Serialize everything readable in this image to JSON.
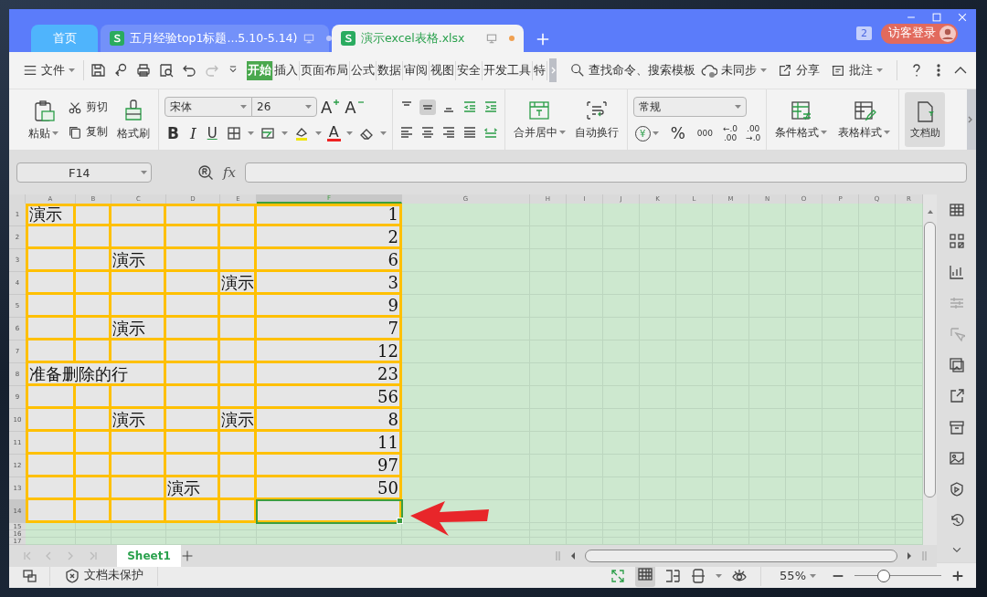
{
  "title_tabs": [
    {
      "kind": "home",
      "label": "首页",
      "selected": false
    },
    {
      "kind": "doc",
      "label": "五月经验top1标题...5.10-5.14)",
      "selected": false
    },
    {
      "kind": "doc",
      "label": "演示excel表格.xlsx",
      "selected": true
    }
  ],
  "window_count": "2",
  "login": "访客登录",
  "file_menu": "文件",
  "menu_tabs": [
    {
      "label": "开始",
      "selected": true
    },
    {
      "label": "插入",
      "selected": false
    },
    {
      "label": "页面布局",
      "selected": false
    },
    {
      "label": "公式",
      "selected": false
    },
    {
      "label": "数据",
      "selected": false
    },
    {
      "label": "审阅",
      "selected": false
    },
    {
      "label": "视图",
      "selected": false
    },
    {
      "label": "安全",
      "selected": false
    },
    {
      "label": "开发工具",
      "selected": false
    },
    {
      "label": "特",
      "selected": false
    }
  ],
  "search": "查找命令、搜索模板",
  "sync": "未同步",
  "share": "分享",
  "comment": "批注",
  "ribbon": {
    "paste": "粘贴",
    "cut": "剪切",
    "copy": "复制",
    "painter": "格式刷",
    "font": "宋体",
    "size": "26",
    "grow": "A",
    "shrink": "A",
    "bold": "B",
    "italic": "I",
    "underline": "U",
    "font_color": "A",
    "merge": "合并居中",
    "wrap": "自动换行",
    "number_format": "常规",
    "currency": "¥",
    "percent": "%",
    "thousands": "000",
    "inc_decimal": [
      "←.0",
      ".00"
    ],
    "dec_decimal": [
      ".00",
      "→.0"
    ],
    "conditional": "条件格式",
    "table_style": "表格样式",
    "assistant": "文档助"
  },
  "name_box": "F14",
  "fx": "fx",
  "columns": [
    "A",
    "B",
    "C",
    "D",
    "E",
    "F",
    "G",
    "H",
    "I",
    "J",
    "K",
    "L",
    "M",
    "N",
    "O",
    "P",
    "Q",
    "R"
  ],
  "rows": [
    {
      "header": "1",
      "A": {
        "kind": "text",
        "text": "演示",
        "selected": false
      },
      "F": {
        "kind": "number",
        "text": "1",
        "selected": false
      }
    },
    {
      "header": "2",
      "F": {
        "kind": "number",
        "text": "2",
        "selected": false
      }
    },
    {
      "header": "3",
      "C": {
        "kind": "text",
        "text": "演示",
        "selected": false
      },
      "F": {
        "kind": "number",
        "text": "6",
        "selected": false
      }
    },
    {
      "header": "4",
      "E": {
        "kind": "text",
        "text": "演示",
        "selected": false
      },
      "F": {
        "kind": "number",
        "text": "3",
        "selected": false
      }
    },
    {
      "header": "5",
      "F": {
        "kind": "number",
        "text": "9",
        "selected": false
      }
    },
    {
      "header": "6",
      "C": {
        "kind": "text",
        "text": "演示",
        "selected": false
      },
      "F": {
        "kind": "number",
        "text": "7",
        "selected": false
      }
    },
    {
      "header": "7",
      "F": {
        "kind": "number",
        "text": "12",
        "selected": false
      }
    },
    {
      "header": "8",
      "A": {
        "kind": "text",
        "text": "准备删除的行",
        "selected": false
      },
      "F": {
        "kind": "number",
        "text": "23",
        "selected": false
      }
    },
    {
      "header": "9",
      "F": {
        "kind": "number",
        "text": "56",
        "selected": false
      }
    },
    {
      "header": "10",
      "C": {
        "kind": "text",
        "text": "演示",
        "selected": false
      },
      "E": {
        "kind": "text",
        "text": "演示",
        "selected": false
      },
      "F": {
        "kind": "number",
        "text": "8",
        "selected": false
      }
    },
    {
      "header": "11",
      "F": {
        "kind": "number",
        "text": "11",
        "selected": false
      }
    },
    {
      "header": "12",
      "F": {
        "kind": "number",
        "text": "97",
        "selected": false
      }
    },
    {
      "header": "13",
      "D": {
        "kind": "text",
        "text": "演示",
        "selected": false
      },
      "F": {
        "kind": "number",
        "text": "50",
        "selected": false
      }
    },
    {
      "header": "14",
      "F": {
        "kind": "number",
        "selected": true
      }
    },
    {
      "header": "15"
    },
    {
      "header": "16"
    },
    {
      "header": "17"
    }
  ],
  "sheets": [
    {
      "label": "Sheet1",
      "selected": true
    }
  ],
  "status": {
    "protection": "文档未保护",
    "zoom": "55%",
    "level": 0.34
  }
}
